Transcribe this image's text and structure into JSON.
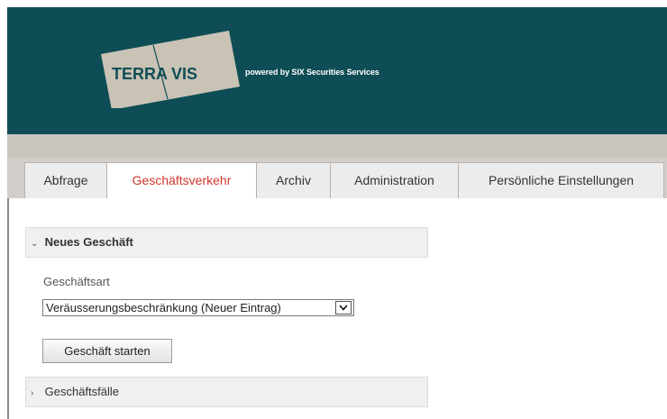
{
  "header": {
    "logo_left": "TERRA",
    "logo_right": "VIS",
    "tagline": "powered by SIX Securities Services",
    "bg_color": "#0e4d55"
  },
  "tabs": [
    {
      "label": "Abfrage",
      "active": false
    },
    {
      "label": "Geschäftsverkehr",
      "active": true
    },
    {
      "label": "Archiv",
      "active": false
    },
    {
      "label": "Administration",
      "active": false
    },
    {
      "label": "Persönliche Einstellungen",
      "active": false
    }
  ],
  "sections": {
    "neues_geschaeft": {
      "title": "Neues Geschäft",
      "icon": "chevron-down-icon",
      "field_label": "Geschäftsart",
      "select_value": "Veräusserungsbeschränkung (Neuer Eintrag)",
      "button_label": "Geschäft starten"
    },
    "geschaeftsfaelle": {
      "title": "Geschäftsfälle",
      "icon": "chevron-right-icon"
    }
  },
  "colors": {
    "accent": "#d0362c",
    "header": "#0e4d55"
  }
}
